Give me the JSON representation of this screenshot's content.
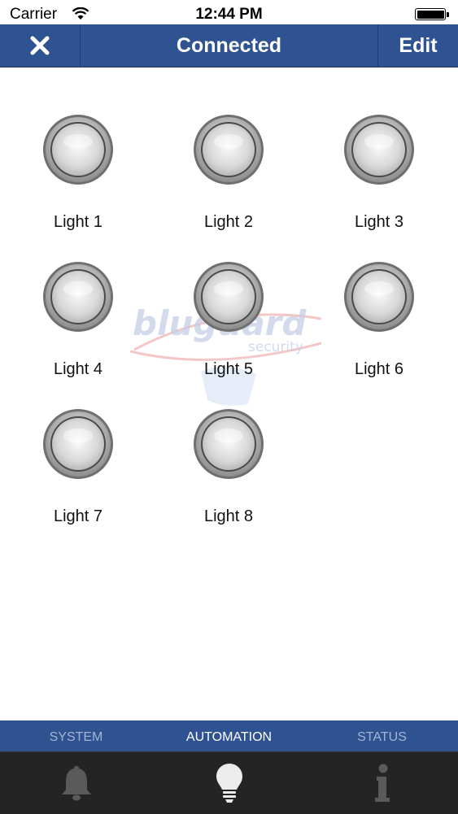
{
  "status_bar": {
    "carrier": "Carrier",
    "time": "12:44 PM"
  },
  "navbar": {
    "title": "Connected",
    "edit_label": "Edit",
    "close_icon": "close-icon"
  },
  "watermark": {
    "brand": "bluguard",
    "tagline": "security"
  },
  "lights": [
    {
      "label": "Light 1"
    },
    {
      "label": "Light 2"
    },
    {
      "label": "Light 3"
    },
    {
      "label": "Light 4"
    },
    {
      "label": "Light 5"
    },
    {
      "label": "Light 6"
    },
    {
      "label": "Light 7"
    },
    {
      "label": "Light 8"
    }
  ],
  "tabs": [
    {
      "label": "SYSTEM",
      "icon": "bell-icon",
      "active": false
    },
    {
      "label": "AUTOMATION",
      "icon": "lightbulb-icon",
      "active": true
    },
    {
      "label": "STATUS",
      "icon": "info-icon",
      "active": false
    }
  ],
  "colors": {
    "navbar": "#2f5290",
    "tabbar_icons": "#242424",
    "tab_inactive": "#a3b5d6",
    "tab_active": "#ffffff"
  }
}
